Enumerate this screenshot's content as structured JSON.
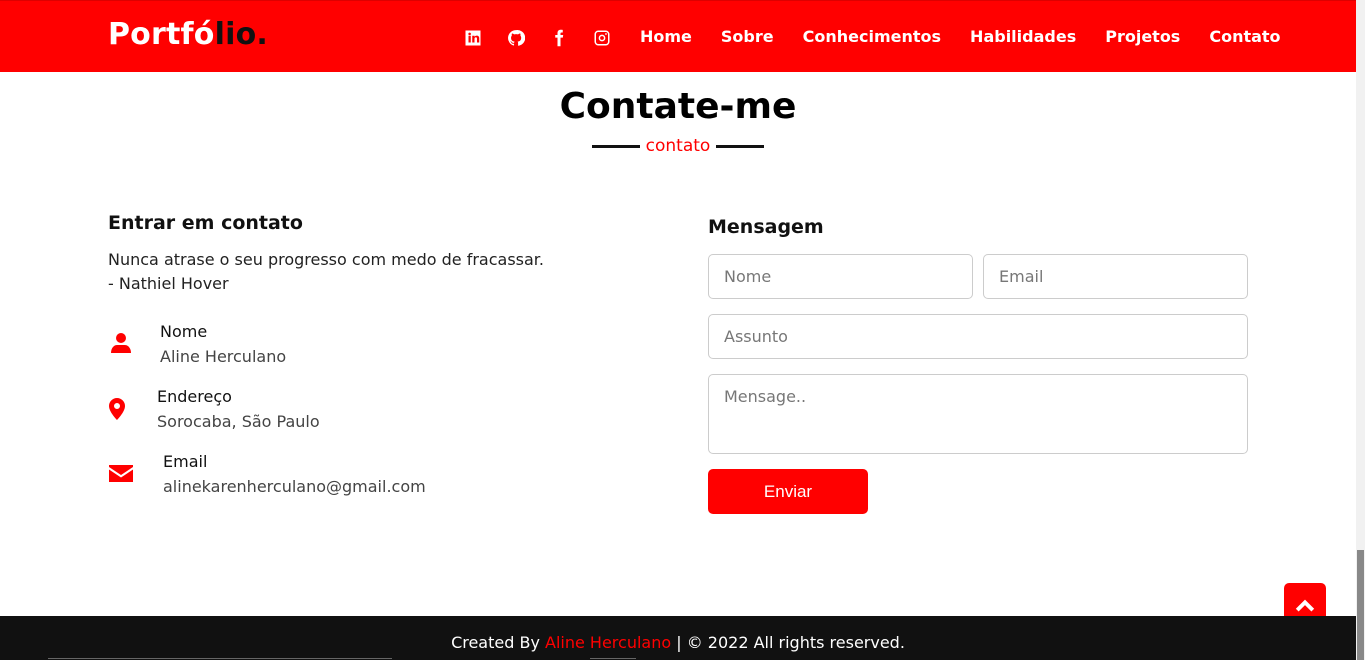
{
  "header": {
    "logo_main": "Portfó",
    "logo_accent": "lio.",
    "social_icons": [
      "linkedin-icon",
      "github-icon",
      "facebook-icon",
      "instagram-icon"
    ],
    "nav": [
      {
        "label": "Home"
      },
      {
        "label": "Sobre"
      },
      {
        "label": "Conhecimentos"
      },
      {
        "label": "Habilidades"
      },
      {
        "label": "Projetos"
      },
      {
        "label": "Contato"
      }
    ]
  },
  "section": {
    "title": "Contate-me",
    "subtitle": "contato"
  },
  "contact_info": {
    "heading": "Entrar em contato",
    "quote_line1": "Nunca atrase o seu progresso com medo de fracassar.",
    "quote_line2": "- Nathiel Hover",
    "items": [
      {
        "label": "Nome",
        "value": "Aline Herculano",
        "icon": "user-icon"
      },
      {
        "label": "Endereço",
        "value": "Sorocaba, São Paulo",
        "icon": "map-marker-icon"
      },
      {
        "label": "Email",
        "value": "alinekarenherculano@gmail.com",
        "icon": "envelope-icon"
      }
    ]
  },
  "form": {
    "heading": "Mensagem",
    "name_placeholder": "Nome",
    "email_placeholder": "Email",
    "subject_placeholder": "Assunto",
    "message_placeholder": "Mensage..",
    "submit_label": "Enviar"
  },
  "footer": {
    "prefix": "Created By",
    "author": "Aline Herculano",
    "suffix": "| © 2022 All rights reserved."
  },
  "colors": {
    "accent": "#ff0000",
    "footer_bg": "#111111"
  }
}
